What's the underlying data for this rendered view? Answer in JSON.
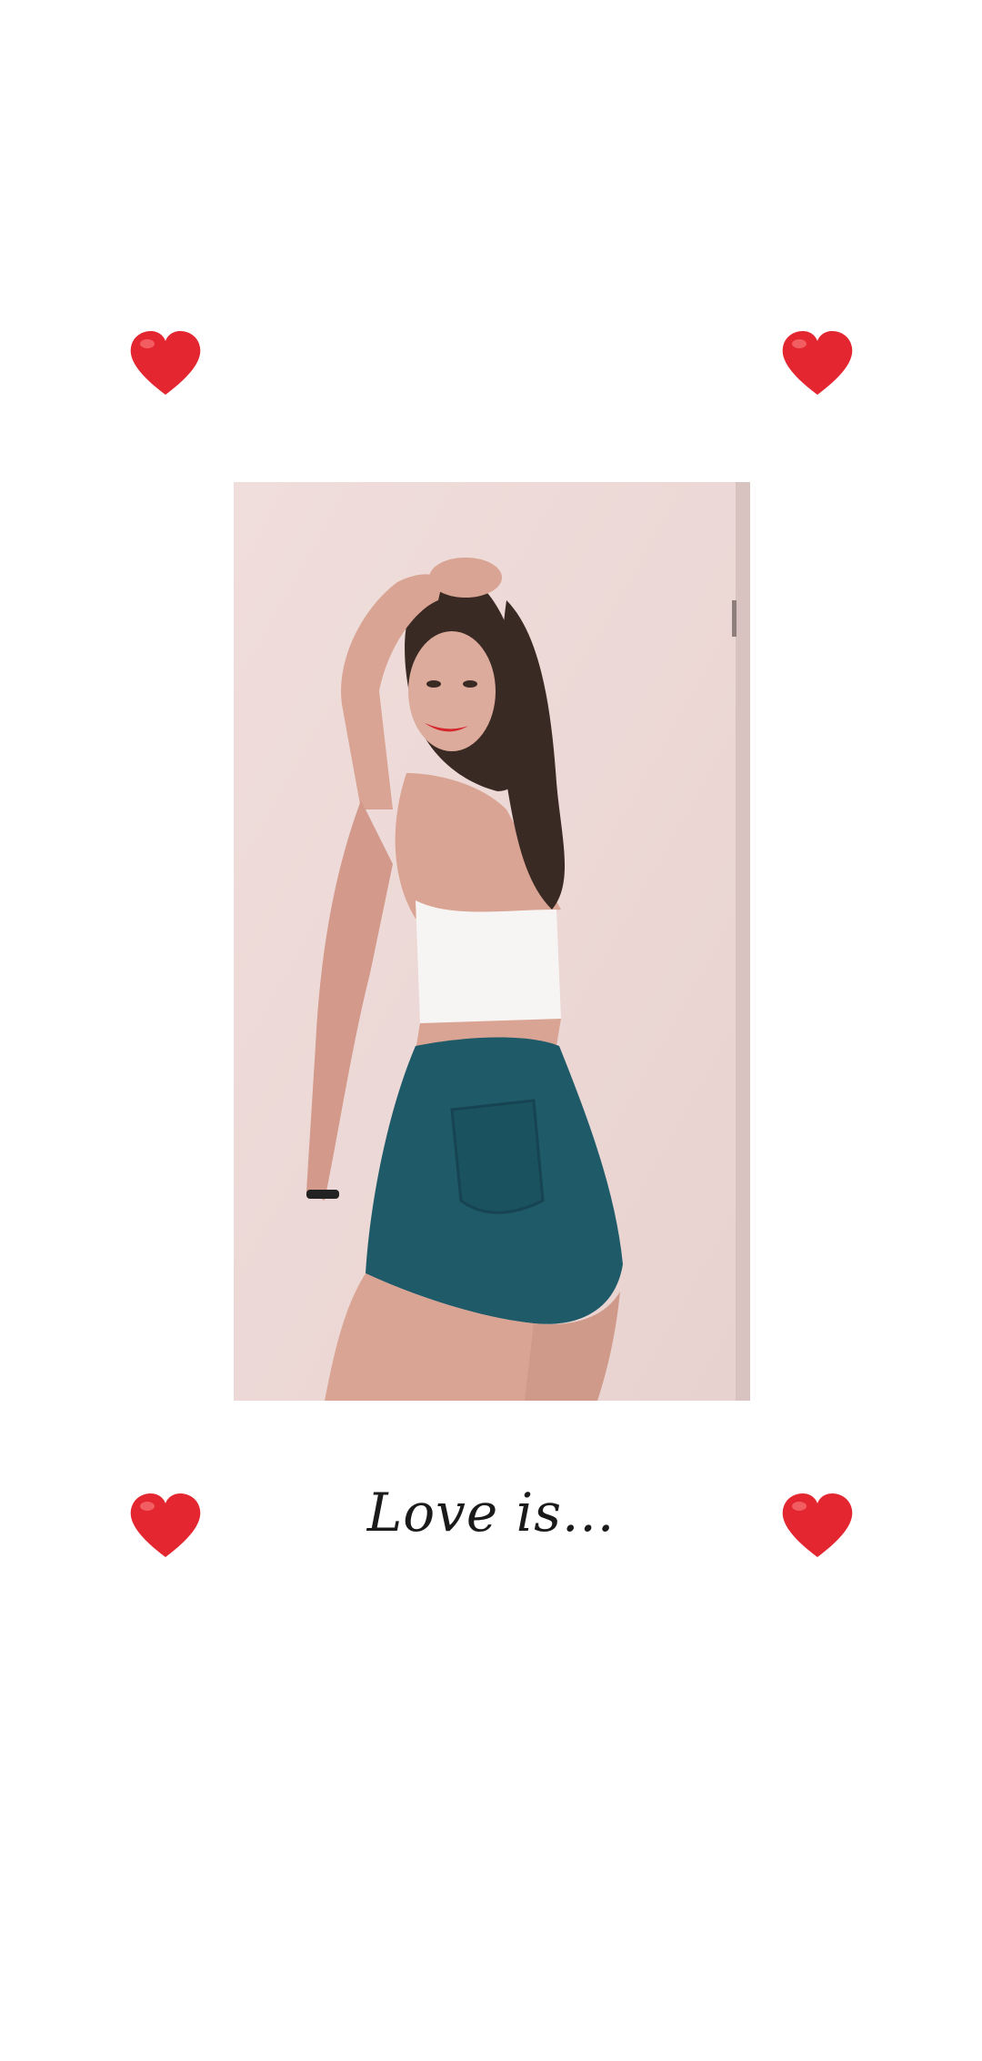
{
  "caption": "Love is...",
  "icons": {
    "corner_heart": "red-heart-icon"
  },
  "colors": {
    "background": "#ffffff",
    "heart": "#e3262f",
    "photo_wall": "#efdcda",
    "shorts": "#1f5a68",
    "top": "#f7f4f4",
    "hair": "#3a2a24",
    "skin": "#d9a493",
    "lips": "#d4262c"
  }
}
